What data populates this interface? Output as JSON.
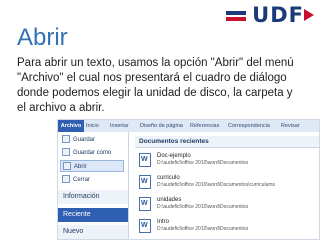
{
  "logo": {
    "text": "UDF"
  },
  "slide": {
    "title": "Abrir",
    "paragraph_lines": [
      "Para abrir un texto, usamos la opción \"Abrir\" del menú",
      "\"Archivo\" el cual nos presentará el  cuadro de diálogo",
      "donde podemos elegir la unidad de disco, la carpeta y",
      "el archivo a abrir."
    ]
  },
  "word": {
    "tabs": [
      "Archivo",
      "Inicio",
      "Insertar",
      "Diseño de página",
      "Referencias",
      "Correspondencia",
      "Revisar"
    ],
    "left_items": [
      "Guardar",
      "Guardar como",
      "Abrir",
      "Cerrar"
    ],
    "sections": {
      "info": "Información",
      "recent": "Reciente",
      "new": "Nuevo"
    },
    "recent_header": "Documentos recientes",
    "documents": [
      {
        "name": "Doc-ejemplo",
        "path": "D:\\audeficl\\office 2010\\word\\Documentos"
      },
      {
        "name": "curriculo",
        "path": "D:\\audeficl\\office 2010\\word\\Documentos\\curriculums"
      },
      {
        "name": "unidades",
        "path": "D:\\audeficl\\office 2010\\word\\Documentos"
      },
      {
        "name": "Intro",
        "path": "D:\\audeficl\\office 2010\\word\\Documentos"
      }
    ]
  },
  "colors": {
    "title": "#3572b3",
    "logo_blue": "#1a3a7a",
    "logo_red": "#c8102e",
    "file_tab": "#2f5fb0"
  }
}
